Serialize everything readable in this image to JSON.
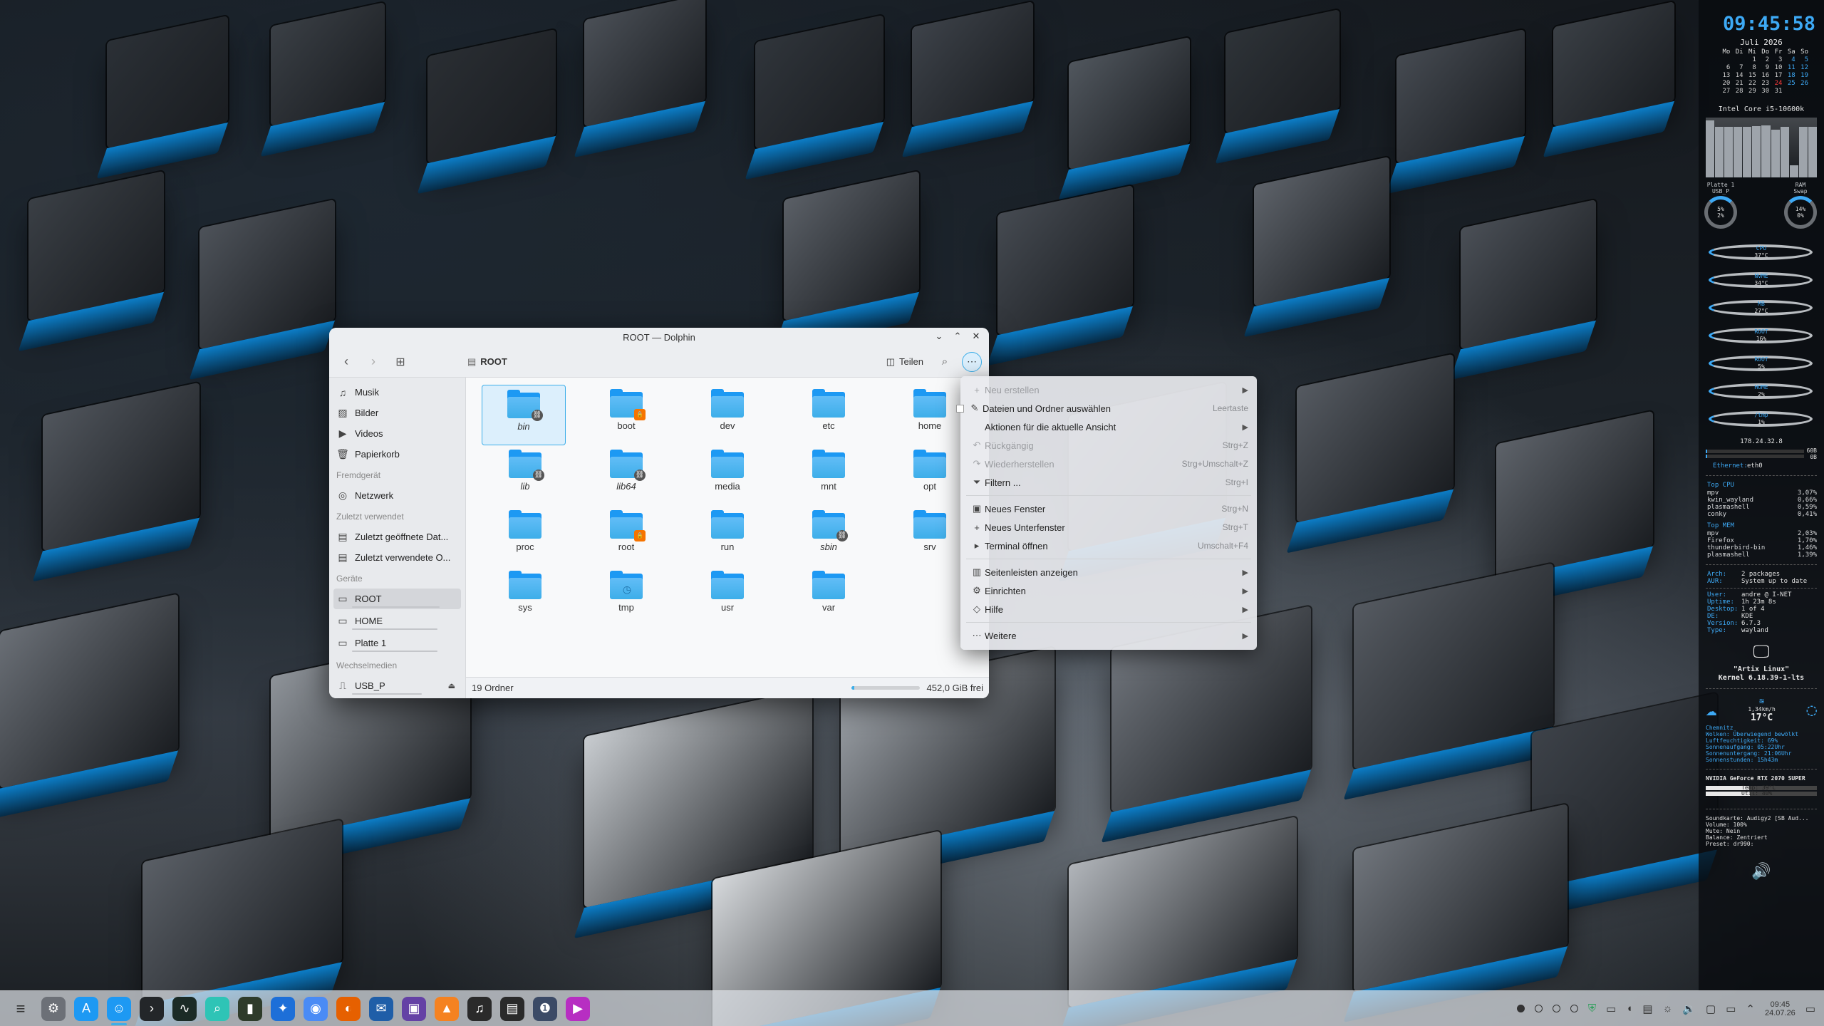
{
  "window": {
    "title": "ROOT — Dolphin",
    "breadcrumb": "ROOT",
    "share_label": "Teilen"
  },
  "sidebar": {
    "places": [
      {
        "label": "Musik",
        "icon": "music-icon"
      },
      {
        "label": "Bilder",
        "icon": "image-icon"
      },
      {
        "label": "Videos",
        "icon": "video-icon"
      },
      {
        "label": "Papierkorb",
        "icon": "trash-icon"
      }
    ],
    "remote_header": "Fremdgerät",
    "remote": [
      {
        "label": "Netzwerk",
        "icon": "network-icon"
      }
    ],
    "recent_header": "Zuletzt verwendet",
    "recent": [
      {
        "label": "Zuletzt geöffnete Dat...",
        "icon": "recent-files-icon"
      },
      {
        "label": "Zuletzt verwendete O...",
        "icon": "recent-folders-icon"
      }
    ],
    "devices_header": "Geräte",
    "devices": [
      {
        "label": "ROOT",
        "icon": "drive-icon",
        "usage": 0.88
      },
      {
        "label": "HOME",
        "icon": "drive-icon",
        "usage": 0.86
      },
      {
        "label": "Platte 1",
        "icon": "drive-icon",
        "usage": 0.86
      }
    ],
    "removable_header": "Wechselmedien",
    "removable": [
      {
        "label": "USB_P",
        "icon": "usb-drive-icon",
        "usage": 0.7
      }
    ]
  },
  "folders": [
    {
      "name": "bin",
      "italic": true,
      "badge": "link",
      "selected": true
    },
    {
      "name": "boot",
      "italic": false,
      "badge": "lock"
    },
    {
      "name": "dev",
      "italic": false,
      "badge": ""
    },
    {
      "name": "etc",
      "italic": false,
      "badge": ""
    },
    {
      "name": "home",
      "italic": false,
      "badge": ""
    },
    {
      "name": "lib",
      "italic": true,
      "badge": "link"
    },
    {
      "name": "lib64",
      "italic": true,
      "badge": "link"
    },
    {
      "name": "media",
      "italic": false,
      "badge": ""
    },
    {
      "name": "mnt",
      "italic": false,
      "badge": ""
    },
    {
      "name": "opt",
      "italic": false,
      "badge": ""
    },
    {
      "name": "proc",
      "italic": false,
      "badge": ""
    },
    {
      "name": "root",
      "italic": false,
      "badge": "lock"
    },
    {
      "name": "run",
      "italic": false,
      "badge": ""
    },
    {
      "name": "sbin",
      "italic": true,
      "badge": "link"
    },
    {
      "name": "srv",
      "italic": false,
      "badge": ""
    },
    {
      "name": "sys",
      "italic": false,
      "badge": ""
    },
    {
      "name": "tmp",
      "italic": false,
      "badge": "clock"
    },
    {
      "name": "usr",
      "italic": false,
      "badge": ""
    },
    {
      "name": "var",
      "italic": false,
      "badge": ""
    }
  ],
  "status": {
    "count": "19 Ordner",
    "free": "452,0 GiB frei",
    "used_fraction": 0.05
  },
  "menu": {
    "items": [
      {
        "label": "Neu erstellen",
        "icon": "plus-icon",
        "shortcut": "",
        "submenu": true,
        "disabled": true
      },
      {
        "label": "Dateien und Ordner auswählen",
        "icon": "checkbox-icon",
        "shortcut": "Leertaste",
        "submenu": false,
        "disabled": false
      },
      {
        "label": "Aktionen für die aktuelle Ansicht",
        "icon": "",
        "shortcut": "",
        "submenu": true,
        "disabled": false
      },
      {
        "label": "Rückgängig",
        "icon": "undo-icon",
        "shortcut": "Strg+Z",
        "submenu": false,
        "disabled": true
      },
      {
        "label": "Wiederherstellen",
        "icon": "redo-icon",
        "shortcut": "Strg+Umschalt+Z",
        "submenu": false,
        "disabled": true
      },
      {
        "label": "Filtern ...",
        "icon": "filter-icon",
        "shortcut": "Strg+I",
        "submenu": false,
        "disabled": false
      },
      {
        "sep": true
      },
      {
        "label": "Neues Fenster",
        "icon": "new-window-icon",
        "shortcut": "Strg+N",
        "submenu": false,
        "disabled": false
      },
      {
        "label": "Neues Unterfenster",
        "icon": "new-tab-icon",
        "shortcut": "Strg+T",
        "submenu": false,
        "disabled": false
      },
      {
        "label": "Terminal öffnen",
        "icon": "terminal-icon",
        "shortcut": "Umschalt+F4",
        "submenu": false,
        "disabled": false
      },
      {
        "sep": true
      },
      {
        "label": "Seitenleisten anzeigen",
        "icon": "sidebar-icon",
        "shortcut": "",
        "submenu": true,
        "disabled": false
      },
      {
        "label": "Einrichten",
        "icon": "settings-icon",
        "shortcut": "",
        "submenu": true,
        "disabled": false
      },
      {
        "label": "Hilfe",
        "icon": "help-icon",
        "shortcut": "",
        "submenu": true,
        "disabled": false
      },
      {
        "sep": true
      },
      {
        "label": "Weitere",
        "icon": "more-icon",
        "shortcut": "",
        "submenu": true,
        "disabled": false
      }
    ]
  },
  "conky": {
    "time": "09:45:58",
    "month": "Juli 2026",
    "weekday_head": [
      "Mo",
      "Di",
      "Mi",
      "Do",
      "Fr",
      "Sa",
      "So"
    ],
    "calendar": [
      [
        "",
        "",
        "1",
        "2",
        "3",
        "4",
        "5"
      ],
      [
        "6",
        "7",
        "8",
        "9",
        "10",
        "11",
        "12"
      ],
      [
        "13",
        "14",
        "15",
        "16",
        "17",
        "18",
        "19"
      ],
      [
        "20",
        "21",
        "22",
        "23",
        "24",
        "25",
        "26"
      ],
      [
        "27",
        "28",
        "29",
        "30",
        "31",
        "",
        ""
      ]
    ],
    "today": "24",
    "cpu_name": "Intel Core i5-10600k",
    "cpu_bars": [
      0.95,
      0.85,
      0.85,
      0.85,
      0.85,
      0.86,
      0.87,
      0.8,
      0.85,
      0.2,
      0.85,
      0.85
    ],
    "disks_left_label_1": "Platte 1",
    "disks_left_label_2": "USB_P",
    "disks_left_val_1": "5%",
    "disks_left_val_2": "2%",
    "ram_label": "RAM",
    "swap_label": "Swap",
    "ram_val": "14%",
    "swap_val": "0%",
    "dials": [
      {
        "label": "CPU",
        "value": "37°C"
      },
      {
        "label": "NVME",
        "value": "34°C"
      },
      {
        "label": "MB",
        "value": "27°C"
      },
      {
        "label": "ROOT",
        "value": "16%"
      },
      {
        "label": "ROOT",
        "value": "5%"
      },
      {
        "label": "HOME",
        "value": "2%"
      },
      {
        "label": "/tmp",
        "value": "1%"
      }
    ],
    "ip": "178.24.32.8",
    "net_up": "60B",
    "net_down": "0B",
    "net_if_label": "Ethernet:",
    "net_if": "eth0",
    "top_cpu_head": "Top CPU",
    "top_cpu": [
      {
        "name": "mpv",
        "val": "3,07%"
      },
      {
        "name": "kwin_wayland",
        "val": "0,66%"
      },
      {
        "name": "plasmashell",
        "val": "0,59%"
      },
      {
        "name": "conky",
        "val": "0,41%"
      }
    ],
    "top_mem_head": "Top MEM",
    "top_mem": [
      {
        "name": "mpv",
        "val": "2,03%"
      },
      {
        "name": "Firefox",
        "val": "1,70%"
      },
      {
        "name": "thunderbird-bin",
        "val": "1,46%"
      },
      {
        "name": "plasmashell",
        "val": "1,39%"
      }
    ],
    "pkg": [
      {
        "k": "Arch:",
        "v": "2 packages"
      },
      {
        "k": "AUR:",
        "v": "System up to date"
      }
    ],
    "sysinfo": [
      {
        "k": "User:",
        "v": "andre @ I-NET"
      },
      {
        "k": "Uptime:",
        "v": "1h 23m 8s"
      },
      {
        "k": "Desktop:",
        "v": "1 of 4"
      },
      {
        "k": "DE:",
        "v": "KDE"
      },
      {
        "k": "Version:",
        "v": "6.7.3"
      },
      {
        "k": "Type:",
        "v": "wayland"
      }
    ],
    "distro": "\"Artix Linux\"",
    "kernel": "Kernel 6.18.39-1-lts",
    "wind": "1,34km/h",
    "temp": "17°C",
    "weather_lines": [
      "Chemnitz",
      "Wolken: Überwiegend bewölkt",
      "Luftfeuchtigkeit: 69%",
      "Sonnenaufgang: 05:22Uhr",
      "Sonnenuntergang: 21:06Uhr",
      "Sonnenstunden: 15h43m"
    ],
    "gpu_name": "NVIDIA GeForce RTX 2070 SUPER",
    "gpu_temp": "Temp: 39°C",
    "gpu_temp_fraction": 0.39,
    "gpu_util": "Util: 40%",
    "gpu_util_fraction": 0.4,
    "sound_lines": [
      "Soundkarte: Audigy2 [SB Aud...",
      "Volume: 100%",
      "Mute: Nein",
      "Balance: Zentriert",
      "Preset: dr990:"
    ]
  },
  "taskbar": {
    "apps": [
      {
        "name": "app-launcher-icon",
        "color": "#3a3d42",
        "glyph": "≡"
      },
      {
        "name": "system-settings-icon",
        "color": "#6c7077",
        "glyph": "⚙"
      },
      {
        "name": "discover-icon",
        "color": "#1d99f3",
        "glyph": "A"
      },
      {
        "name": "dolphin-icon",
        "color": "#1d99f3",
        "glyph": "☺",
        "active": true
      },
      {
        "name": "terminal-icon",
        "color": "#232629",
        "glyph": "›"
      },
      {
        "name": "system-monitor-icon",
        "color": "#1b2b26",
        "glyph": "∿"
      },
      {
        "name": "search-app-icon",
        "color": "#2ec4b6",
        "glyph": "⌕"
      },
      {
        "name": "nvidia-settings-icon",
        "color": "#2e3b2a",
        "glyph": "▮"
      },
      {
        "name": "app-store-icon",
        "color": "#1d6fd8",
        "glyph": "✦"
      },
      {
        "name": "chromium-icon",
        "color": "#4a8bf5",
        "glyph": "◉"
      },
      {
        "name": "firefox-icon",
        "color": "#e66000",
        "glyph": "◐"
      },
      {
        "name": "thunderbird-icon",
        "color": "#1f5ea8",
        "glyph": "✉"
      },
      {
        "name": "twitch-icon",
        "color": "#6441a5",
        "glyph": "▣"
      },
      {
        "name": "vlc-icon",
        "color": "#f58220",
        "glyph": "▲"
      },
      {
        "name": "music-player-icon",
        "color": "#2a2a2a",
        "glyph": "♫"
      },
      {
        "name": "mkv-tool-icon",
        "color": "#2a2a2a",
        "glyph": "▤"
      },
      {
        "name": "keepass-icon",
        "color": "#3b4a66",
        "glyph": "❶"
      },
      {
        "name": "media-player-icon",
        "color": "#b72ec2",
        "glyph": "▶"
      }
    ],
    "clock_time": "09:45",
    "clock_date": "24.07.26"
  }
}
